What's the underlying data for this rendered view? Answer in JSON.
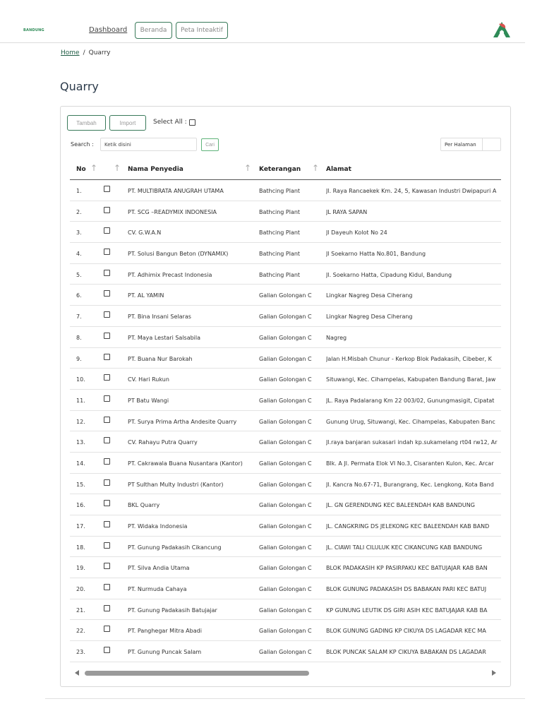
{
  "nav": {
    "logo_text": "BANDUNG",
    "dashboard": "Dashboard",
    "beranda": "Beranda",
    "peta": "Peta Inteaktif"
  },
  "breadcrumb": {
    "home": "Home",
    "separator": "/",
    "current": "Quarry"
  },
  "page": {
    "title": "Quarry"
  },
  "toolbar": {
    "tambah": "Tambah",
    "import": "Import",
    "select_all": "Select All :"
  },
  "search": {
    "label": "Search :",
    "placeholder": "Ketik disini",
    "button": "Cari",
    "per_page_label": "Per Halaman"
  },
  "table": {
    "headers": {
      "no": "No",
      "nama": "Nama Penyedia",
      "keterangan": "Keterangan",
      "alamat": "Alamat"
    },
    "rows": [
      {
        "no": "1.",
        "nama": "PT. MULTIBRATA ANUGRAH UTAMA",
        "ket": "Bathcing Plant",
        "alamat": "Jl. Raya Rancaekek Km. 24, 5, Kawasan Industri Dwipapuri A"
      },
      {
        "no": "2.",
        "nama": "PT. SCG –READYMIX INDONESIA",
        "ket": "Bathcing Plant",
        "alamat": "JL RAYA SAPAN"
      },
      {
        "no": "3.",
        "nama": "CV. G.W.A.N",
        "ket": "Bathcing Plant",
        "alamat": "Jl Dayeuh Kolot No 24"
      },
      {
        "no": "4.",
        "nama": "PT. Solusi Bangun Beton (DYNAMIX)",
        "ket": "Bathcing Plant",
        "alamat": "Jl Soekarno Hatta No.801, Bandung"
      },
      {
        "no": "5.",
        "nama": "PT. Adhimix Precast Indonesia",
        "ket": "Bathcing Plant",
        "alamat": "Jl. Soekarno Hatta, Cipadung Kidul, Bandung"
      },
      {
        "no": "6.",
        "nama": "PT. AL YAMIN",
        "ket": "Galian Golongan C",
        "alamat": "Lingkar Nagreg Desa Ciherang"
      },
      {
        "no": "7.",
        "nama": "PT. Bina Insani Selaras",
        "ket": "Galian Golongan C",
        "alamat": "Lingkar Nagreg Desa Ciherang"
      },
      {
        "no": "8.",
        "nama": "PT. Maya Lestari Salsabila",
        "ket": "Galian Golongan C",
        "alamat": "Nagreg"
      },
      {
        "no": "9.",
        "nama": "PT. Buana Nur Barokah",
        "ket": "Galian Golongan C",
        "alamat": "Jalan H.Misbah Chunur - Kerkop Blok Padakasih, Cibeber, K"
      },
      {
        "no": "10.",
        "nama": "CV. Hari Rukun",
        "ket": "Galian Golongan C",
        "alamat": "Situwangi, Kec. Cihampelas, Kabupaten Bandung Barat, Jaw"
      },
      {
        "no": "11.",
        "nama": "PT Batu Wangi",
        "ket": "Galian Golongan C",
        "alamat": "JL. Raya Padalarang Km 22 003/02, Gunungmasigit, Cipatat"
      },
      {
        "no": "12.",
        "nama": "PT. Surya Prima Artha Andesite Quarry",
        "ket": "Galian Golongan C",
        "alamat": "Gunung Urug, Situwangi, Kec. Cihampelas, Kabupaten Banc"
      },
      {
        "no": "13.",
        "nama": "CV. Rahayu Putra Quarry",
        "ket": "Galian Golongan C",
        "alamat": "Jl.raya banjaran sukasari indah kp.sukamelang rt04 rw12, Ar"
      },
      {
        "no": "14.",
        "nama": "PT. Cakrawala Buana Nusantara (Kantor)",
        "ket": "Galian Golongan C",
        "alamat": "Blk. A Jl. Permata Elok VI No.3, Cisaranten Kulon, Kec. Arcar"
      },
      {
        "no": "15.",
        "nama": "PT Sulthan Multy Industri (Kantor)",
        "ket": "Galian Golongan C",
        "alamat": "Jl. Kancra No.67-71, Burangrang, Kec. Lengkong, Kota Band"
      },
      {
        "no": "16.",
        "nama": "BKL Quarry",
        "ket": "Galian Golongan C",
        "alamat": "JL. GN GERENDUNG KEC BALEENDAH KAB BANDUNG"
      },
      {
        "no": "17.",
        "nama": "PT. Widaka Indonesia",
        "ket": "Galian Golongan C",
        "alamat": "JL. CANGKRING DS JELEKONG KEC BALEENDAH KAB BAND"
      },
      {
        "no": "18.",
        "nama": "PT. Gunung Padakasih Cikancung",
        "ket": "Galian Golongan C",
        "alamat": "JL. CIAWI TALI CILULUK KEC CIKANCUNG KAB BANDUNG"
      },
      {
        "no": "19.",
        "nama": "PT. Silva Andia Utama",
        "ket": "Galian Golongan C",
        "alamat": "BLOK PADAKASIH KP PASIRPAKU KEC BATUJAJAR KAB BAN"
      },
      {
        "no": "20.",
        "nama": "PT. Nurmuda Cahaya",
        "ket": "Galian Golongan C",
        "alamat": "BLOK GUNUNG PADAKASIH DS BABAKAN PARI KEC BATUJ"
      },
      {
        "no": "21.",
        "nama": "PT. Gunung Padakasih Batujajar",
        "ket": "Galian Golongan C",
        "alamat": "KP GUNUNG LEUTIK DS GIRI ASIH KEC BATUJAJAR KAB BA"
      },
      {
        "no": "22.",
        "nama": "PT. Panghegar Mitra Abadi",
        "ket": "Galian Golongan C",
        "alamat": "BLOK GUNUNG GADING KP CIKUYA DS LAGADAR KEC MA"
      },
      {
        "no": "23.",
        "nama": "PT. Gunung Puncak Salam",
        "ket": "Galian Golongan C",
        "alamat": "BLOK PUNCAK SALAM KP CIKUYA BABAKAN DS LAGADAR"
      }
    ]
  },
  "colors": {
    "accent": "#3a7a5a",
    "brand_red": "#d9534f",
    "brand_green": "#2e8b57"
  }
}
